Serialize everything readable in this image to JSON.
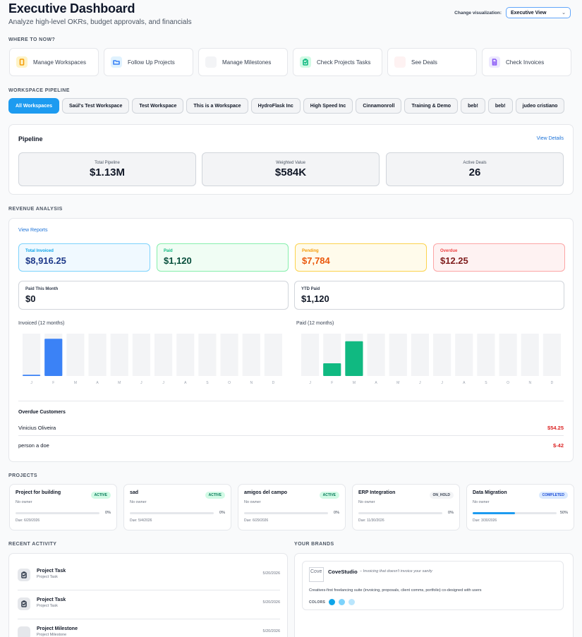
{
  "header": {
    "title": "Executive Dashboard",
    "subtitle": "Analyze high-level OKRs, budget approvals, and financials",
    "viz_label": "Change visualization:",
    "viz_value": "Executive View"
  },
  "sections": {
    "where_to": "WHERE TO NOW?",
    "workspace_pipeline": "WORKSPACE PIPELINE",
    "revenue_analysis": "REVENUE ANALYSIS",
    "projects": "PROJECTS",
    "recent_activity": "RECENT ACTIVITY",
    "your_brands": "YOUR BRANDS"
  },
  "quick_actions": [
    {
      "label": "Manage Workspaces",
      "icon": "tablet-icon",
      "color": "#f59e0b",
      "bg": "#fef3c7"
    },
    {
      "label": "Follow Up Projects",
      "icon": "folder-icon",
      "color": "#3b82f6",
      "bg": "#e0f2fe"
    },
    {
      "label": "Manage Milestones",
      "icon": "",
      "color": "#9ca3af",
      "bg": "#f3f4f6"
    },
    {
      "label": "Check Projects Tasks",
      "icon": "clipboard-icon",
      "color": "#10b981",
      "bg": "#d1fae5"
    },
    {
      "label": "See Deals",
      "icon": "",
      "color": "#f87171",
      "bg": "#fef2f2"
    },
    {
      "label": "Check Invoices",
      "icon": "document-icon",
      "color": "#8b5cf6",
      "bg": "#ede9fe"
    }
  ],
  "workspaces": [
    "All Workspaces",
    "Saúl's Test Workspace",
    "Test Workspace",
    "This is a Workspace",
    "HydroFlask Inc",
    "High Speed Inc",
    "Cinnamonroll",
    "Training & Demo",
    "beb!",
    "beb!",
    "judeo cristiano"
  ],
  "pipeline": {
    "title": "Pipeline",
    "view_details": "View Details",
    "stats": [
      {
        "label": "Total Pipeline",
        "value": "$1.13M"
      },
      {
        "label": "Weighted Value",
        "value": "$584K"
      },
      {
        "label": "Active Deals",
        "value": "26"
      }
    ]
  },
  "revenue": {
    "view_reports": "View Reports",
    "cards": [
      {
        "label": "Total Invoiced",
        "value": "$8,916.25",
        "label_color": "#0ea5e9",
        "value_color": "#1e3a8a",
        "bg": "#f0f9ff",
        "border": "#7dd3fc"
      },
      {
        "label": "Paid",
        "value": "$1,120",
        "label_color": "#10b981",
        "value_color": "#064e3b",
        "bg": "#f0fdf4",
        "border": "#86efac"
      },
      {
        "label": "Pending",
        "value": "$7,784",
        "label_color": "#f59e0b",
        "value_color": "#ea580c",
        "bg": "#fffbeb",
        "border": "#fcd34d"
      },
      {
        "label": "Overdue",
        "value": "$12.25",
        "label_color": "#ef4444",
        "value_color": "#7f1d1d",
        "bg": "#fef2f2",
        "border": "#fca5a5"
      }
    ],
    "paid_this_month": {
      "label": "Paid This Month",
      "value": "$0"
    },
    "ytd_paid": {
      "label": "YTD Paid",
      "value": "$1,120"
    },
    "invoiced_chart_title": "Invoiced (12 months)",
    "paid_chart_title": "Paid (12 months)",
    "overdue_title": "Overdue Customers",
    "overdue_customers": [
      {
        "name": "Vinicius Oliveira",
        "amount": "$54.25"
      },
      {
        "name": "person a doe",
        "amount": "$-42"
      }
    ]
  },
  "chart_data": [
    {
      "type": "bar",
      "title": "Invoiced (12 months)",
      "categories": [
        "J",
        "F",
        "M",
        "A",
        "M",
        "J",
        "J",
        "A",
        "S",
        "O",
        "N",
        "D"
      ],
      "values": [
        0.03,
        0.88,
        0,
        0,
        0,
        0,
        0,
        0,
        0,
        0,
        0,
        0
      ],
      "ylim": [
        0,
        1
      ],
      "color": "#3b82f6"
    },
    {
      "type": "bar",
      "title": "Paid (12 months)",
      "categories": [
        "J",
        "F",
        "M",
        "A",
        "M",
        "J",
        "J",
        "A",
        "S",
        "O",
        "N",
        "D"
      ],
      "values": [
        0,
        0.3,
        0.82,
        0,
        0,
        0,
        0,
        0,
        0,
        0,
        0,
        0
      ],
      "ylim": [
        0,
        1
      ],
      "color": "#10b981"
    }
  ],
  "projects": [
    {
      "name": "Project for building",
      "status": "ACTIVE",
      "owner": "No owner",
      "progress": 0,
      "progress_label": "0%",
      "due": "Due: 6/29/2026"
    },
    {
      "name": "sad",
      "status": "ACTIVE",
      "owner": "No owner",
      "progress": 0,
      "progress_label": "0%",
      "due": "Due: 5/4/2026"
    },
    {
      "name": "amigos del campo",
      "status": "ACTIVE",
      "owner": "No owner",
      "progress": 0,
      "progress_label": "0%",
      "due": "Due: 6/29/2026"
    },
    {
      "name": "ERP Integration",
      "status": "ON_HOLD",
      "owner": "No owner",
      "progress": 0,
      "progress_label": "0%",
      "due": "Due: 11/30/2026"
    },
    {
      "name": "Data Migration",
      "status": "COMPLETED",
      "owner": "No owner",
      "progress": 50,
      "progress_label": "50%",
      "due": "Due: 3/30/2026"
    }
  ],
  "status_colors": {
    "ACTIVE": {
      "bg": "#d1fae5",
      "fg": "#047857"
    },
    "ON_HOLD": {
      "bg": "#f3f4f6",
      "fg": "#374151"
    },
    "COMPLETED": {
      "bg": "#dbeafe",
      "fg": "#1d4ed8"
    }
  },
  "activity": [
    {
      "title": "Project Task",
      "subtitle": "Project Task",
      "date": "5/20/2026",
      "icon": "clipboard-icon"
    },
    {
      "title": "Project Task",
      "subtitle": "Project Task",
      "date": "5/20/2026",
      "icon": "clipboard-icon"
    },
    {
      "title": "Project Milestone",
      "subtitle": "Project Milestone",
      "date": "5/20/2026",
      "icon": ""
    }
  ],
  "brand": {
    "logo_alt": "Cove",
    "name": "CoveStudio",
    "tagline": "– Invoicing that doesn't invoice your sanity",
    "description": "Creatives-first freelancing suite (invoicing, proposals, client comms, portfolio) co-designed with users",
    "colors_label": "COLORS",
    "colors": [
      "#0ea5e9",
      "#7dd3fc",
      "#bae6fd"
    ]
  }
}
